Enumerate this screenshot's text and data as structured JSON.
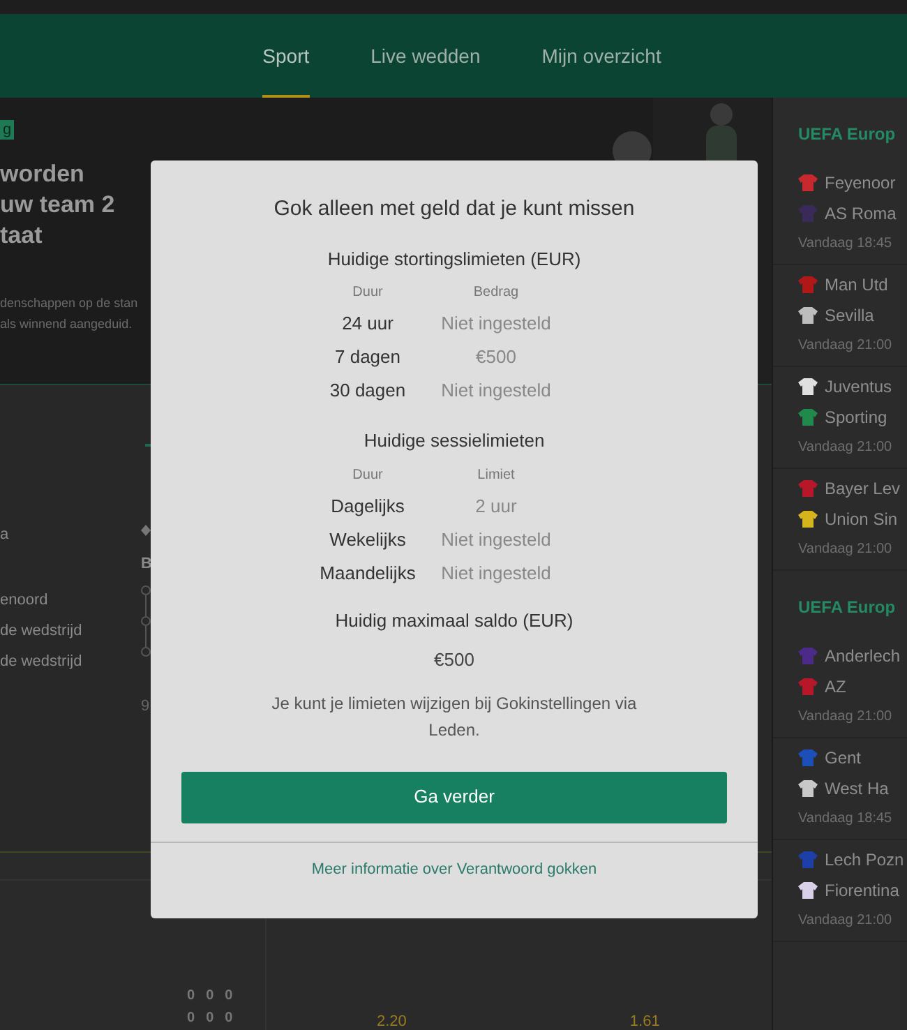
{
  "nav": {
    "tabs": [
      {
        "label": "Sport",
        "selected": true
      },
      {
        "label": "Live wedden",
        "selected": false
      },
      {
        "label": "Mijn overzicht",
        "selected": false
      }
    ]
  },
  "banner": {
    "badge": "g",
    "headline": [
      "worden",
      "uw team 2",
      "taat"
    ],
    "description": [
      "denschappen op de stan",
      "als winnend aangeduid."
    ]
  },
  "market": {
    "labels": [
      "a",
      "enoord",
      "de wedstrijd",
      "de wedstrijd"
    ],
    "column_2": [
      "B",
      "9"
    ]
  },
  "scores": [
    [
      "0",
      "0",
      "0"
    ],
    [
      "0",
      "0",
      "0"
    ]
  ],
  "odds": [
    "2.20",
    "1.61"
  ],
  "sidebar": {
    "sections": [
      {
        "title": "UEFA Europ",
        "matches": [
          {
            "teams": [
              {
                "name": "Feyenoor",
                "color": "#c8292e"
              },
              {
                "name": "AS Roma",
                "color": "#3a2a5a"
              }
            ],
            "time": "Vandaag 18:45"
          },
          {
            "teams": [
              {
                "name": "Man Utd",
                "color": "#b01818"
              },
              {
                "name": "Sevilla",
                "color": "#bdbdbd"
              }
            ],
            "time": "Vandaag 21:00"
          },
          {
            "teams": [
              {
                "name": "Juventus",
                "color": "#e0e0e0"
              },
              {
                "name": "Sporting",
                "color": "#1f8a4c"
              }
            ],
            "time": "Vandaag 21:00"
          },
          {
            "teams": [
              {
                "name": "Bayer Lev",
                "color": "#b8172a"
              },
              {
                "name": "Union Sin",
                "color": "#d6b51c"
              }
            ],
            "time": "Vandaag 21:00"
          }
        ]
      },
      {
        "title": "UEFA Europ",
        "matches": [
          {
            "teams": [
              {
                "name": "Anderlech",
                "color": "#4b2a8a"
              },
              {
                "name": "AZ",
                "color": "#b8172a"
              }
            ],
            "time": "Vandaag 21:00"
          },
          {
            "teams": [
              {
                "name": "Gent",
                "color": "#1c4fb8"
              },
              {
                "name": "West Ha",
                "color": "#c8c8c8"
              }
            ],
            "time": "Vandaag 18:45"
          },
          {
            "teams": [
              {
                "name": "Lech Pozn",
                "color": "#1c3fa8"
              },
              {
                "name": "Fiorentina",
                "color": "#d8d0e8"
              }
            ],
            "time": "Vandaag 21:00"
          }
        ]
      }
    ]
  },
  "modal": {
    "title": "Gok alleen met geld dat je kunt missen",
    "deposit": {
      "heading": "Huidige stortingslimieten (EUR)",
      "columns": [
        "Duur",
        "Bedrag"
      ],
      "rows": [
        {
          "period": "24 uur",
          "value": "Niet ingesteld"
        },
        {
          "period": "7 dagen",
          "value": "€500"
        },
        {
          "period": "30 dagen",
          "value": "Niet ingesteld"
        }
      ]
    },
    "session": {
      "heading": "Huidige sessielimieten",
      "columns": [
        "Duur",
        "Limiet"
      ],
      "rows": [
        {
          "period": "Dagelijks",
          "value": "2 uur"
        },
        {
          "period": "Wekelijks",
          "value": "Niet ingesteld"
        },
        {
          "period": "Maandelijks",
          "value": "Niet ingesteld"
        }
      ]
    },
    "balance_heading": "Huidig maximaal saldo (EUR)",
    "balance": "€500",
    "note": "Je kunt je limieten wijzigen bij Gokinstellingen via Leden.",
    "button": "Ga verder",
    "link": "Meer informatie over Verantwoord gokken"
  }
}
